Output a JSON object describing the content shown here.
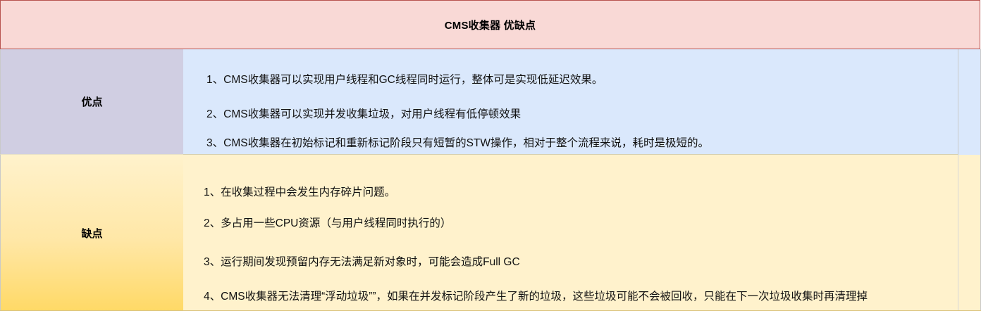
{
  "title": "CMS收集器 优缺点",
  "pros": {
    "label": "优点",
    "items": [
      "1、CMS收集器可以实现用户线程和GC线程同时运行，整体可是实现低延迟效果。",
      "2、CMS收集器可以实现并发收集垃圾，对用户线程有低停顿效果",
      "3、CMS收集器在初始标记和重新标记阶段只有短暂的STW操作，相对于整个流程来说，耗时是极短的。"
    ]
  },
  "cons": {
    "label": "缺点",
    "items": [
      "1、在收集过程中会发生内存碎片问题。",
      "2、多占用一些CPU资源（与用户线程同时执行的）",
      "3、运行期间发现预留内存无法满足新对象时，可能会造成Full GC",
      "4、CMS收集器无法清理“浮动垃圾””，如果在并发标记阶段产生了新的垃圾，这些垃圾可能不会被回收，只能在下一次垃圾收集时再清理掉"
    ]
  },
  "colors": {
    "title_bg": "#f9d9d6",
    "title_border": "#b85450",
    "pros_label_bg": "#d0cee2",
    "pros_content_bg": "#dae8fc",
    "cons_content_bg": "#fff2cc",
    "cons_label_gradient_end": "#ffd966"
  }
}
